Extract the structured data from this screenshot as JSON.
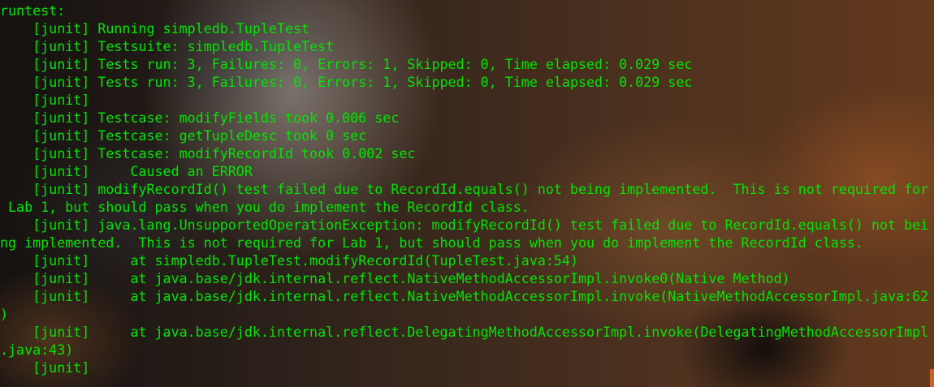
{
  "terminal": {
    "text_color": "#00e600",
    "lines": [
      "runtest:",
      "    [junit] Running simpledb.TupleTest",
      "    [junit] Testsuite: simpledb.TupleTest",
      "    [junit] Tests run: 3, Failures: 0, Errors: 1, Skipped: 0, Time elapsed: 0.029 sec",
      "    [junit] Tests run: 3, Failures: 0, Errors: 1, Skipped: 0, Time elapsed: 0.029 sec",
      "    [junit] ",
      "    [junit] Testcase: modifyFields took 0.006 sec",
      "    [junit] Testcase: getTupleDesc took 0 sec",
      "    [junit] Testcase: modifyRecordId took 0.002 sec",
      "    [junit]     Caused an ERROR",
      "    [junit] modifyRecordId() test failed due to RecordId.equals() not being implemented.  This is not required for",
      " Lab 1, but should pass when you do implement the RecordId class.",
      "    [junit] java.lang.UnsupportedOperationException: modifyRecordId() test failed due to RecordId.equals() not bei",
      "ng implemented.  This is not required for Lab 1, but should pass when you do implement the RecordId class.",
      "    [junit]     at simpledb.TupleTest.modifyRecordId(TupleTest.java:54)",
      "    [junit]     at java.base/jdk.internal.reflect.NativeMethodAccessorImpl.invoke0(Native Method)",
      "    [junit]     at java.base/jdk.internal.reflect.NativeMethodAccessorImpl.invoke(NativeMethodAccessorImpl.java:62",
      ")",
      "    [junit]     at java.base/jdk.internal.reflect.DelegatingMethodAccessorImpl.invoke(DelegatingMethodAccessorImpl",
      ".java:43)",
      "    [junit]"
    ]
  }
}
